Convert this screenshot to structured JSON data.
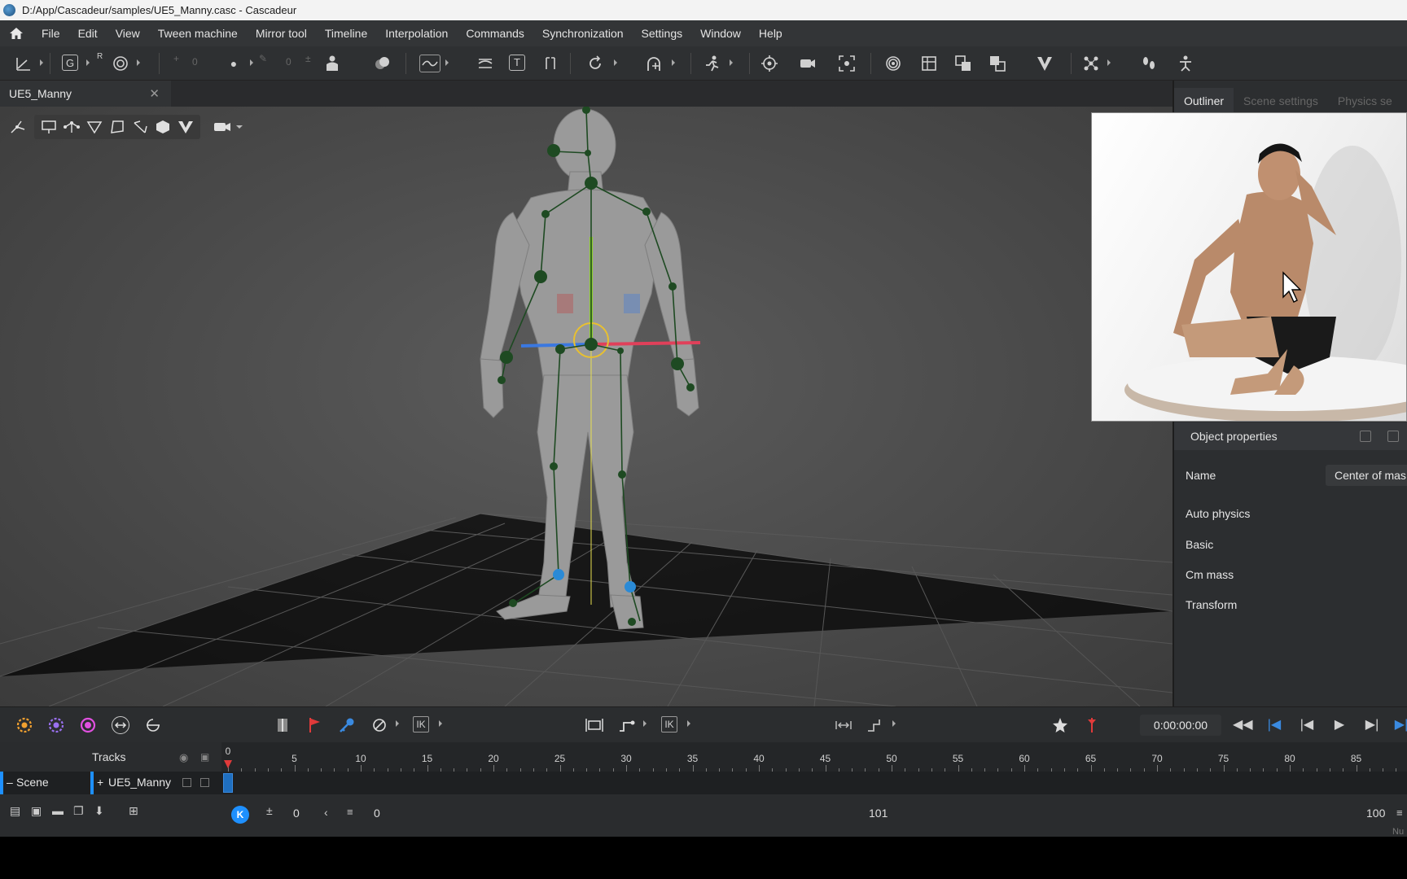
{
  "window": {
    "title": "D:/App/Cascadeur/samples/UE5_Manny.casc - Cascadeur"
  },
  "menu": {
    "items": [
      "File",
      "Edit",
      "View",
      "Tween machine",
      "Mirror tool",
      "Timeline",
      "Interpolation",
      "Commands",
      "Synchronization",
      "Settings",
      "Window",
      "Help"
    ]
  },
  "toolbar": {
    "g_label": "G",
    "r_label": "R",
    "t_label": "T",
    "num_a": "0",
    "num_b": "0"
  },
  "doc_tab": {
    "label": "UE5_Manny",
    "close": "✕"
  },
  "viewport_tools": {
    "ik": "IK"
  },
  "right_panel": {
    "tabs": [
      "Outliner",
      "Scene settings",
      "Physics se"
    ],
    "props_title": "Object properties",
    "name_label": "Name",
    "name_value": "Center of mas",
    "sections": [
      "Auto physics",
      "Basic",
      "Cm mass",
      "Transform"
    ]
  },
  "timeline_bar": {
    "ik1": "IK",
    "ik2": "IK",
    "ik3": "IK",
    "timecode": "0:00:00:00"
  },
  "tracks": {
    "header": "Tracks",
    "scene": "Scene",
    "object": "UE5_Manny",
    "ruler_labels": [
      "0",
      "5",
      "10",
      "15",
      "20",
      "25",
      "30",
      "35",
      "40",
      "45",
      "50",
      "55",
      "60",
      "65",
      "70",
      "75",
      "80",
      "85"
    ],
    "footer_left": "0",
    "footer_mid": "0",
    "footer_center": "101",
    "footer_right": "100",
    "corner_label": "Nu"
  },
  "colors": {
    "accent_blue": "#1e90ff",
    "keyframe_red": "#e03a3a",
    "bone_green": "#1e4a22",
    "axis_x": "#e0405a",
    "axis_y": "#8ccf2a",
    "axis_z": "#3a78e0"
  }
}
